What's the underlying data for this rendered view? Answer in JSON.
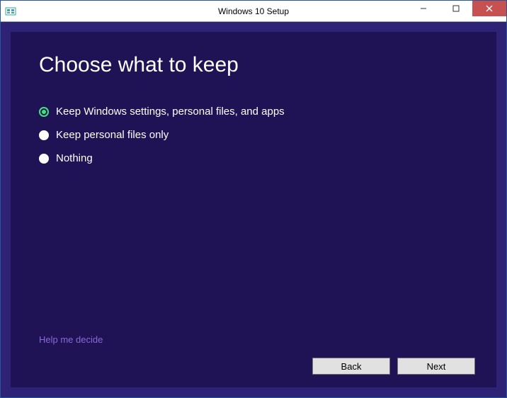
{
  "window": {
    "title": "Windows 10 Setup"
  },
  "main": {
    "heading": "Choose what to keep",
    "options": [
      {
        "label": "Keep Windows settings, personal files, and apps",
        "selected": true
      },
      {
        "label": "Keep personal files only",
        "selected": false
      },
      {
        "label": "Nothing",
        "selected": false
      }
    ],
    "help_link": "Help me decide"
  },
  "buttons": {
    "back": "Back",
    "next": "Next"
  }
}
